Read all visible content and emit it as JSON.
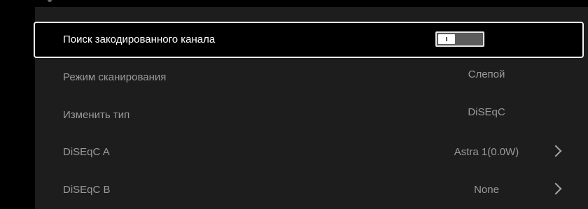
{
  "settings": {
    "rows": [
      {
        "label": "Поиск закодированного канала",
        "value": "",
        "control": "toggle",
        "toggle_on": false,
        "focused": true
      },
      {
        "label": "Режим сканирования",
        "value": "Слепой"
      },
      {
        "label": "Изменить тип",
        "value": "DiSEqC"
      },
      {
        "label": "DiSEqC A",
        "value": "Astra 1(0.0W)",
        "icon": "chevron-right-icon"
      },
      {
        "label": "DiSEqC B",
        "value": "None",
        "icon": "chevron-right-icon"
      }
    ]
  },
  "colors": {
    "background": "#000000",
    "panel": "#1d1d1d",
    "focus_border": "#f2f2f2",
    "text_focused": "#ffffff",
    "text_normal": "#9a9a9a"
  }
}
